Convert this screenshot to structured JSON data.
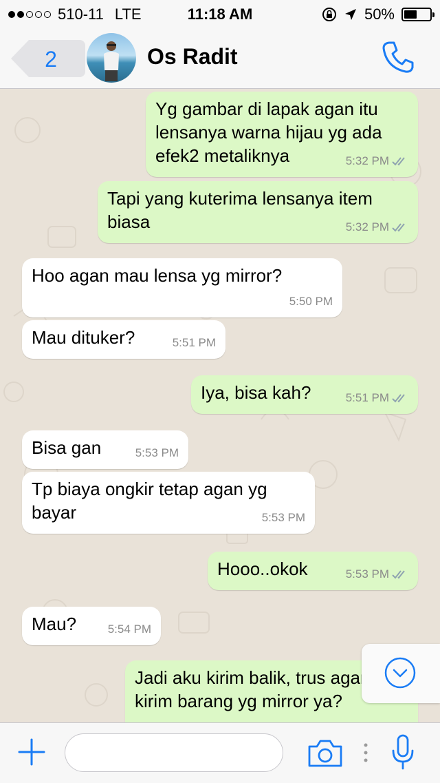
{
  "status_bar": {
    "carrier": "510-11",
    "network": "LTE",
    "time": "11:18 AM",
    "battery": "50%",
    "battery_level": 0.5,
    "signal_dots_filled": 2,
    "signal_dots_total": 5
  },
  "header": {
    "back_count": "2",
    "contact_name": "Os Radit"
  },
  "messages": [
    {
      "direction": "out",
      "text": "Yg gambar di lapak agan itu lensanya warna hijau yg ada efek2 metaliknya",
      "time": "5:32 PM",
      "read": true
    },
    {
      "direction": "out",
      "text": "Tapi yang kuterima lensanya item biasa",
      "time": "5:32 PM",
      "read": true
    },
    {
      "direction": "in",
      "text": "Hoo agan mau lensa yg mirror?",
      "time": "5:50 PM"
    },
    {
      "direction": "in",
      "text": "Mau dituker?",
      "time": "5:51 PM"
    },
    {
      "direction": "out",
      "text": "Iya, bisa kah?",
      "time": "5:51 PM",
      "read": true
    },
    {
      "direction": "in",
      "text": "Bisa gan",
      "time": "5:53 PM"
    },
    {
      "direction": "in",
      "text": "Tp biaya ongkir tetap agan yg bayar",
      "time": "5:53 PM"
    },
    {
      "direction": "out",
      "text": "Hooo..okok",
      "time": "5:53 PM",
      "read": true
    },
    {
      "direction": "in",
      "text": "Mau?",
      "time": "5:54 PM"
    },
    {
      "direction": "out",
      "text": "Jadi aku kirim balik, trus agan kirim barang yg mirror ya?",
      "time": "",
      "read": false
    }
  ],
  "input": {
    "value": "",
    "placeholder": ""
  },
  "colors": {
    "accent": "#1a7cf5",
    "outgoing_bubble": "#dcf8c6",
    "incoming_bubble": "#ffffff",
    "chat_background": "#e9e2d8",
    "read_ticks": "#8fa3b0"
  },
  "icons": {
    "back": "chevron-left-icon",
    "call": "phone-icon",
    "scroll": "chevron-down-circle-icon",
    "attach": "plus-icon",
    "camera": "camera-icon",
    "more": "vertical-dots-icon",
    "mic": "microphone-icon",
    "lock": "rotation-lock-icon",
    "location": "location-arrow-icon"
  }
}
